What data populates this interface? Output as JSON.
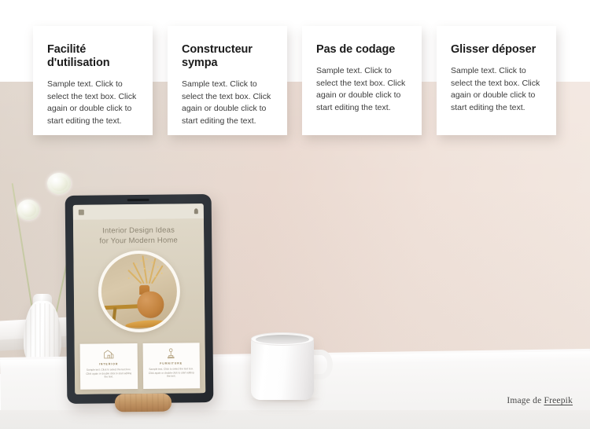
{
  "page": {
    "title": "Feature cards over interior design workspace photo",
    "background_top_color": "#ffffff",
    "wall_color": "#e6dbd2",
    "desk_color": "#f7f6f5"
  },
  "cards": [
    {
      "id": "facilite-utilisation",
      "title": "Facilité d'utilisation",
      "body": "Sample text. Click to select the text box. Click again or double click to start editing the text."
    },
    {
      "id": "constructeur-sympa",
      "title": "Constructeur sympa",
      "body": "Sample text. Click to select the text box. Click again or double click to start editing the text."
    },
    {
      "id": "pas-de-codage",
      "title": "Pas de codage",
      "body": "Sample text. Click to select the text box. Click again or double click to start editing the text."
    },
    {
      "id": "glisser-deposer",
      "title": "Glisser déposer",
      "body": "Sample text. Click to select the text box. Click again or double click to start editing the text."
    }
  ],
  "tablet": {
    "header": {
      "menu_icon": "hamburger-menu-icon",
      "right_icon": "bell-icon"
    },
    "hero_title_line1": "Interior Design Ideas",
    "hero_title_line2": "for Your Modern Home",
    "hero_image_alt": "terracotta vase with dried golden branches on a wooden table",
    "mini_cards": [
      {
        "icon": "interior-room-icon",
        "caption": "INTERIOR",
        "body": "Sample text. Click to select the text box. Click again or double click to start editing the text."
      },
      {
        "icon": "furniture-lamp-icon",
        "caption": "FURNITURE",
        "body": "Sample text. Click to select the text box. Click again or double click to start editing the text."
      }
    ]
  },
  "scene": {
    "vase_alt": "white ribbed ceramic vase with two dried allium flowers",
    "mug_alt": "white ceramic coffee mug",
    "stand_alt": "wooden cylindrical tablet stand"
  },
  "credit": {
    "prefix": "Image de ",
    "link_text": "Freepik"
  }
}
